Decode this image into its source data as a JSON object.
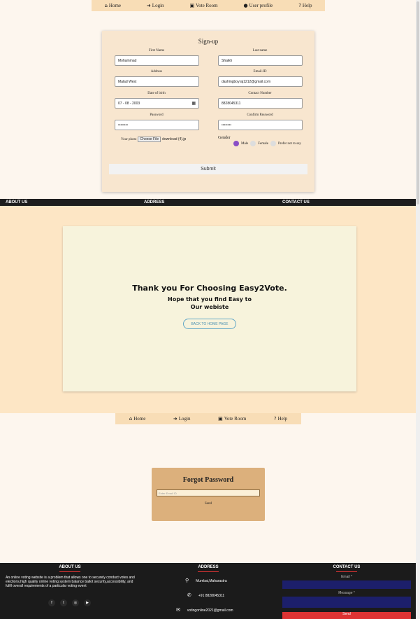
{
  "nav": {
    "home": "Home",
    "login": "Login",
    "vote_room": "Vote Room",
    "user_profile": "User profile",
    "help": "Help"
  },
  "signup": {
    "title": "Sign-up",
    "first_name_label": "First Name",
    "first_name_value": "Mohammad",
    "last_name_label": "Last name",
    "last_name_value": "Shaikh",
    "address_label": "Address",
    "address_value": "Malad West",
    "email_label": "Email-ID",
    "email_value": "dashingboyraj1212@gmail.com",
    "dob_label": "Date of birth",
    "dob_value": "07 - 08 - 2003",
    "contact_label": "Contact Number",
    "contact_value": "8828045311",
    "password_label": "Password",
    "password_value": "••••••••",
    "confirm_label": "Confirm Password",
    "confirm_value": "••••••••",
    "photo_label": "Your photo",
    "choose_file": "Choose File",
    "file_name": "download (4).jp",
    "gender_label": "Gender",
    "male": "Male",
    "female": "Female",
    "prefer_not": "Prefer not to say",
    "submit": "Submit"
  },
  "strip": {
    "about": "ABOUT US",
    "address": "ADDRESS",
    "contact": "CONTACT US"
  },
  "thanks": {
    "line1": "Thank you For Choosing Easy2Vote.",
    "line2": "Hope that you find Easy to",
    "line3": "Our webiste",
    "back_button": "BACK TO HOME PAGE"
  },
  "nav2": {
    "home": "Home",
    "login": "Login",
    "vote_room": "Vote Room",
    "help": "Help"
  },
  "forgot": {
    "title": "Forgot Password",
    "placeholder": "Enter Email ID",
    "send": "Send"
  },
  "footer": {
    "about_head": "ABOUT US",
    "about_text": "An online voting website is a problem that allows one to securely conduct votes and elections,high quality online voting system balance ballot security,accessibility, and fulfil overall requirements of a particular voting event",
    "address_head": "ADDRESS",
    "location": "Mumbai,Maharastra",
    "phone": "+91 8828045311",
    "email": "votingonline2021@gmail.com",
    "contact_head": "CONTACT US",
    "email_label": "Email *",
    "message_label": "Message *",
    "send": "Send"
  },
  "icons": {
    "home": "home-icon",
    "login": "sign-in-icon",
    "vote": "vote-box-icon",
    "user": "user-circle-icon",
    "help": "question-icon"
  },
  "colors": {
    "nav_bg": "#f8ddb6",
    "accent_red": "#dd3333",
    "radio": "#8a4ec6",
    "footer_bg": "#1b1b1b"
  }
}
